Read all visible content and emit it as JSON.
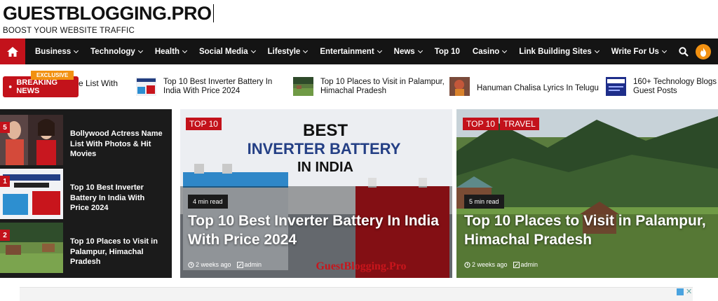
{
  "site": {
    "logo": "GUESTBLOGGING.PRO",
    "tagline": "BOOST YOUR WEBSITE TRAFFIC"
  },
  "nav": {
    "items": [
      {
        "label": "Business",
        "dropdown": true
      },
      {
        "label": "Technology",
        "dropdown": true
      },
      {
        "label": "Health",
        "dropdown": true
      },
      {
        "label": "Social Media",
        "dropdown": true
      },
      {
        "label": "Lifestyle",
        "dropdown": true
      },
      {
        "label": "Entertainment",
        "dropdown": true
      },
      {
        "label": "News",
        "dropdown": true
      },
      {
        "label": "Top 10",
        "dropdown": false
      },
      {
        "label": "Casino",
        "dropdown": true
      },
      {
        "label": "Link Building Sites",
        "dropdown": true
      },
      {
        "label": "Write For Us",
        "dropdown": true
      }
    ],
    "icons": [
      "home-icon",
      "search-icon",
      "dark-mode-icon"
    ]
  },
  "ticker": {
    "exclusive": "EXCLUSIVE",
    "label": "BREAKING NEWS",
    "partial": "e List With",
    "items": [
      {
        "title": "Top 10 Best Inverter Battery In India With Price 2024"
      },
      {
        "title": "Top 10 Places to Visit in Palampur, Himachal Pradesh"
      },
      {
        "title": "Hanuman Chalisa Lyrics In Telugu"
      },
      {
        "title": "160+ Technology Blogs Guest Posts"
      }
    ]
  },
  "sidebar": {
    "items": [
      {
        "num": "5",
        "title": "Bollywood Actress Name List With Photos & Hit Movies"
      },
      {
        "num": "1",
        "title": "Top 10 Best Inverter Battery In India With Price 2024"
      },
      {
        "num": "2",
        "title": "Top 10 Places to Visit in Palampur, Himachal Pradesh"
      }
    ]
  },
  "featured": [
    {
      "badges": [
        "TOP 10"
      ],
      "read_time": "4 min read",
      "title": "Top 10 Best Inverter Battery In India With Price 2024",
      "date": "2 weeks ago",
      "author": "admin",
      "image_text": {
        "line1": "BEST",
        "line2": "INVERTER BATTERY",
        "line3": "IN INDIA",
        "watermark": "GuestBlogging.Pro"
      }
    },
    {
      "badges": [
        "TOP 10",
        "TRAVEL"
      ],
      "read_time": "5 min read",
      "title": "Top 10 Places to Visit in Palampur, Himachal Pradesh",
      "date": "2 weeks ago",
      "author": "admin"
    }
  ],
  "colors": {
    "accent": "#c3121b",
    "nav_bg": "#141414",
    "orange": "#f29111",
    "panel_bg": "#1b1b1b"
  }
}
